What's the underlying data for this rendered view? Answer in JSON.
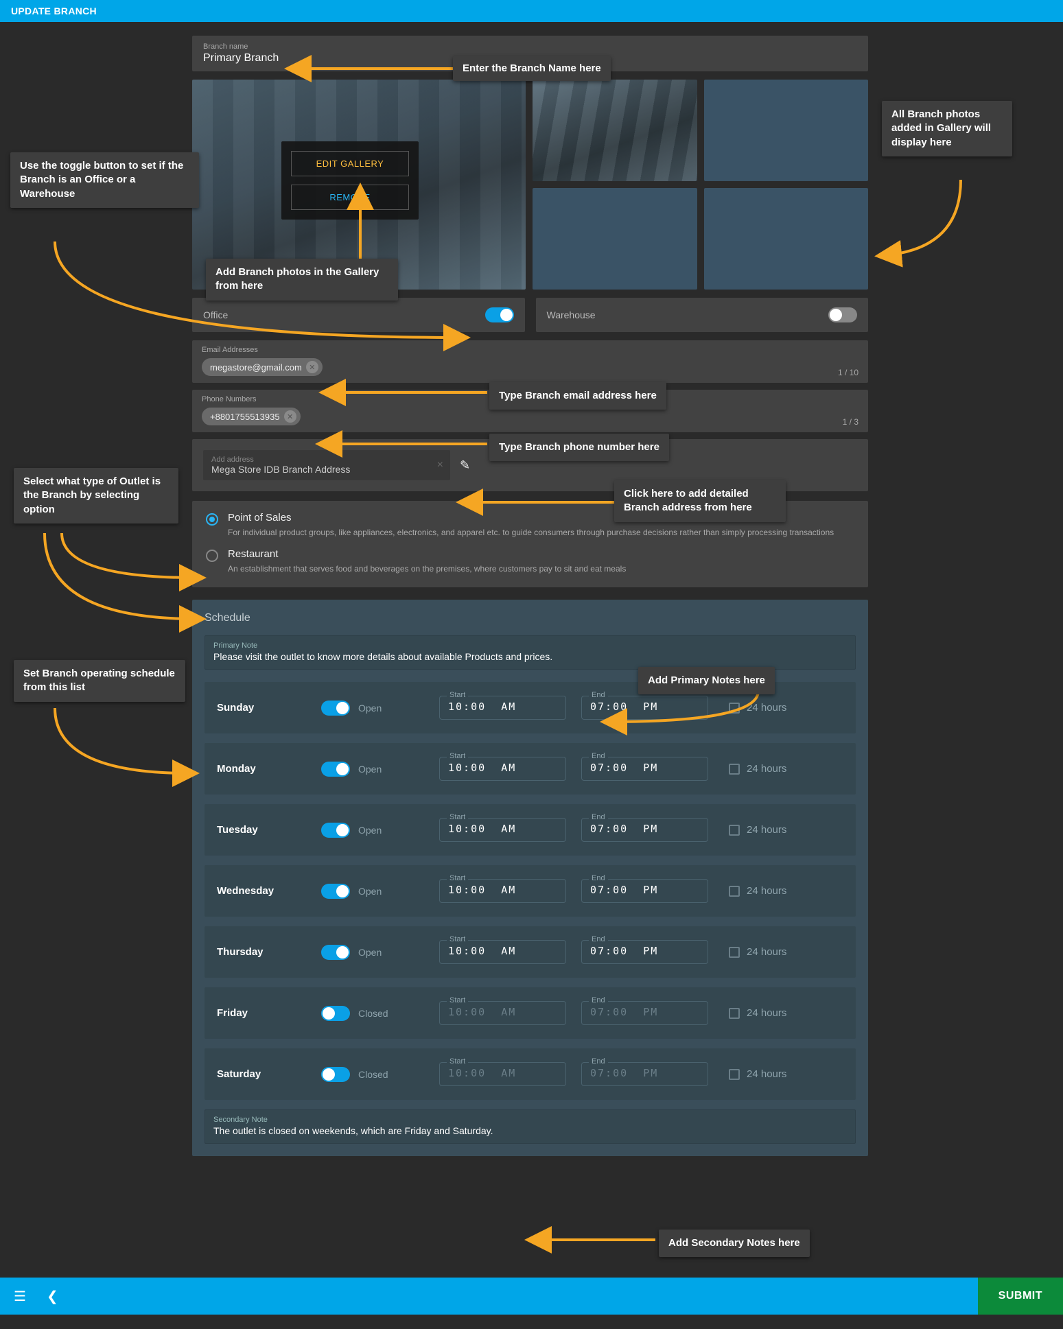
{
  "topbar": {
    "title": "UPDATE BRANCH"
  },
  "branch_name": {
    "label": "Branch name",
    "value": "Primary Branch"
  },
  "gallery": {
    "edit_label": "EDIT GALLERY",
    "remove_label": "REMOVE"
  },
  "toggles": {
    "office": {
      "label": "Office",
      "on": true
    },
    "warehouse": {
      "label": "Warehouse",
      "on": false
    }
  },
  "emails": {
    "label": "Email Addresses",
    "chip": "megastore@gmail.com",
    "counter": "1 / 10"
  },
  "phones": {
    "label": "Phone Numbers",
    "chip": "+8801755513935",
    "counter": "1 / 3"
  },
  "address": {
    "hint": "Add address",
    "value": "Mega Store IDB Branch Address"
  },
  "outlet_types": [
    {
      "title": "Point of Sales",
      "desc": "For individual product groups, like appliances, electronics, and apparel etc. to guide consumers through purchase decisions rather than simply processing transactions",
      "selected": true
    },
    {
      "title": "Restaurant",
      "desc": "An establishment that serves food and beverages on the premises, where customers pay to sit and eat meals",
      "selected": false
    }
  ],
  "schedule": {
    "title": "Schedule",
    "primary_note": {
      "label": "Primary Note",
      "value": "Please visit the outlet to know more details about available Products and prices."
    },
    "secondary_note": {
      "label": "Secondary Note",
      "value": "The outlet is closed on weekends, which are Friday and Saturday."
    },
    "start_label": "Start",
    "end_label": "End",
    "h24_label": "24 hours",
    "open_label": "Open",
    "closed_label": "Closed",
    "days": [
      {
        "name": "Sunday",
        "open": true,
        "start": "10:00 AM",
        "end": "07:00 PM"
      },
      {
        "name": "Monday",
        "open": true,
        "start": "10:00 AM",
        "end": "07:00 PM"
      },
      {
        "name": "Tuesday",
        "open": true,
        "start": "10:00 AM",
        "end": "07:00 PM"
      },
      {
        "name": "Wednesday",
        "open": true,
        "start": "10:00 AM",
        "end": "07:00 PM"
      },
      {
        "name": "Thursday",
        "open": true,
        "start": "10:00 AM",
        "end": "07:00 PM"
      },
      {
        "name": "Friday",
        "open": false,
        "start": "10:00 AM",
        "end": "07:00 PM"
      },
      {
        "name": "Saturday",
        "open": false,
        "start": "10:00 AM",
        "end": "07:00 PM"
      }
    ]
  },
  "bottombar": {
    "submit": "SUBMIT"
  },
  "callouts": {
    "c_name": "Enter the Branch Name here",
    "c_photos_display": "All Branch photos added in Gallery will display here",
    "c_add_photos": "Add Branch photos in the Gallery from here",
    "c_toggle": "Use the toggle button to set if the Branch is an Office or a Warehouse",
    "c_email": "Type Branch email address here",
    "c_phone": "Type Branch phone number here",
    "c_addr_edit": "Click here to add detailed Branch address from here",
    "c_outlet": "Select what type of Outlet is the Branch by selecting option",
    "c_schedule": "Set Branch operating schedule from this list",
    "c_prim_note": "Add Primary Notes here",
    "c_sec_note": "Add Secondary Notes here"
  }
}
